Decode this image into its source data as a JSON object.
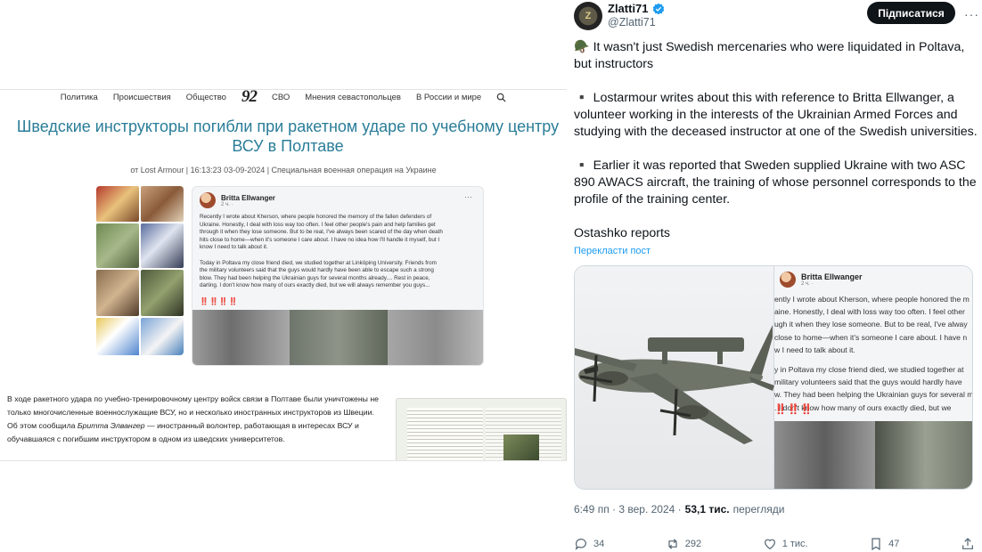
{
  "article": {
    "nav": [
      "Политика",
      "Происшествия",
      "Общество",
      "СВО",
      "Мнения севастопольцев",
      "В России и мире"
    ],
    "logo": "92",
    "headline": "Шведские инструкторы погибли при ракетном ударе по учебному центру ВСУ в Полтаве",
    "byline": "от Lost Armour | 16:13:23 03-09-2024 | Специальная военная операция на Украине",
    "fb_post": {
      "author": "Britta Ellwanger",
      "time": "2 ч. · ",
      "more": "···",
      "text": "Recently I wrote about Kherson, where people honored the memory of the fallen defenders of\nUkraine. Honestly, I deal with loss way too often. I feel other people's pain and help families get\nthrough it when they lose someone. But to be real, I've always been scared of the day when death\nhits close to home—when it's someone I care about. I have no idea how I'll handle it myself, but I\nknow I need to talk about it.\n\nToday in Poltava my close friend died, we studied together at Linköping University. Friends from\nthe military volunteers said that the guys would hardly have been able to escape such a strong\nblow. They had been helping the Ukrainian guys for several months already.... Rest in peace,\ndarling. I don't know how many of ours exactly died, but we will always remember you guys...",
      "emoji": "‼️‼️‼️‼️"
    },
    "paragraph_before": "В ходе ракетного удара по учебно-тренировочному центру войск связи в Полтаве были уничтожены не только многочисленные военнослужащие ВСУ, но и несколько иностранных инструкторов из Швеции. Об этом сообщила ",
    "paragraph_name": "Бритта Элвангер",
    "paragraph_after": " — иностранный волонтер, работающая в интересах ВСУ и обучавшаяся с погибшим инструктором в одном из шведских университетов."
  },
  "tweet": {
    "author": "Zlatti71",
    "handle": "@Zlatti71",
    "follow_label": "Підписатися",
    "more": "···",
    "paragraphs": [
      "🪖 It wasn't just Swedish mercenaries who were liquidated in Poltava, but instructors",
      "▪️ Lostarmour writes about this with reference to Britta Ellwanger, a volunteer working in the interests of the Ukrainian Armed Forces and studying with the deceased instructor at one of the Swedish universities.",
      "▪️ Earlier it was reported that Sweden supplied Ukraine with two ASC 890 AWACS aircraft, the training of whose personnel corresponds to the profile of the training center."
    ],
    "source": "Ostashko reports",
    "translate": "Перекласти пост",
    "media_fb": {
      "author": "Britta Ellwanger",
      "time": "2 ч. · ",
      "lines": [
        "ently I wrote about Kherson, where people honored the m",
        "aine. Honestly, I deal with loss way too often. I feel other",
        "ugh it when they lose someone. But to be real, I've alway",
        "close to home—when it's someone I care about. I have n",
        "w I need to talk about it.",
        "",
        "y in Poltava my close friend died, we studied together at",
        "military volunteers said that the guys would hardly have",
        "w. They had been helping the Ukrainian guys for several m",
        ". I don't know how many of ours exactly died, but we"
      ],
      "emoji": "‼️‼️‼️"
    },
    "time": "6:49 пп · 3 вер. 2024 ·",
    "views_count": "53,1 тис.",
    "views_label": "перегляди",
    "replies": "34",
    "reposts": "292",
    "likes": "1 тис.",
    "bookmarks": "47"
  },
  "colors": {
    "headline": "#2a7d98",
    "verified": "#1d9bf0",
    "link": "#1d9bf0",
    "follow_bg": "#0f1419"
  }
}
